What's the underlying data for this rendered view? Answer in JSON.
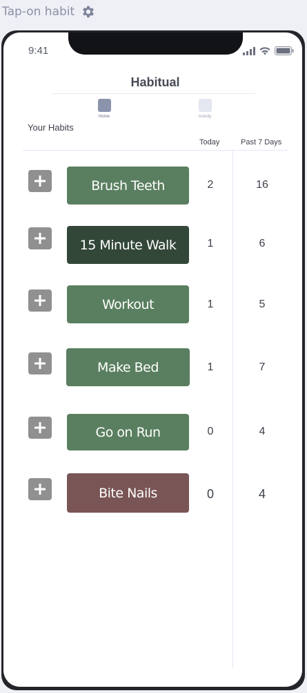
{
  "header": {
    "title": "Tap-on habit",
    "settings_icon": "gear-icon"
  },
  "status_bar": {
    "time": "9:41"
  },
  "app": {
    "title": "Habitual",
    "tabs": [
      {
        "label": "Home",
        "icon": "home-tab-icon",
        "active": true
      },
      {
        "label": "Activity",
        "icon": "activity-tab-icon",
        "active": false
      }
    ],
    "section_label": "Your Habits",
    "columns": {
      "today": "Today",
      "past": "Past 7 Days"
    }
  },
  "habits": [
    {
      "name": "Brush Teeth",
      "today": "2",
      "past": "16",
      "color": "#5a7f60"
    },
    {
      "name": "15 Minute Walk",
      "today": "1",
      "past": "6",
      "color": "#334739"
    },
    {
      "name": "Workout",
      "today": "1",
      "past": "5",
      "color": "#5a7f60"
    },
    {
      "name": "Make Bed",
      "today": "1",
      "past": "7",
      "color": "#5a7f60"
    },
    {
      "name": "Go on Run",
      "today": "0",
      "past": "4",
      "color": "#5a7f60"
    },
    {
      "name": "Bite Nails",
      "today": "0",
      "past": "4",
      "color": "#7a5555"
    }
  ],
  "colors": {
    "healthy_habit": "#5a7f60",
    "active_habit": "#334739",
    "bad_habit": "#7a5555",
    "plus_button": "#909090"
  }
}
